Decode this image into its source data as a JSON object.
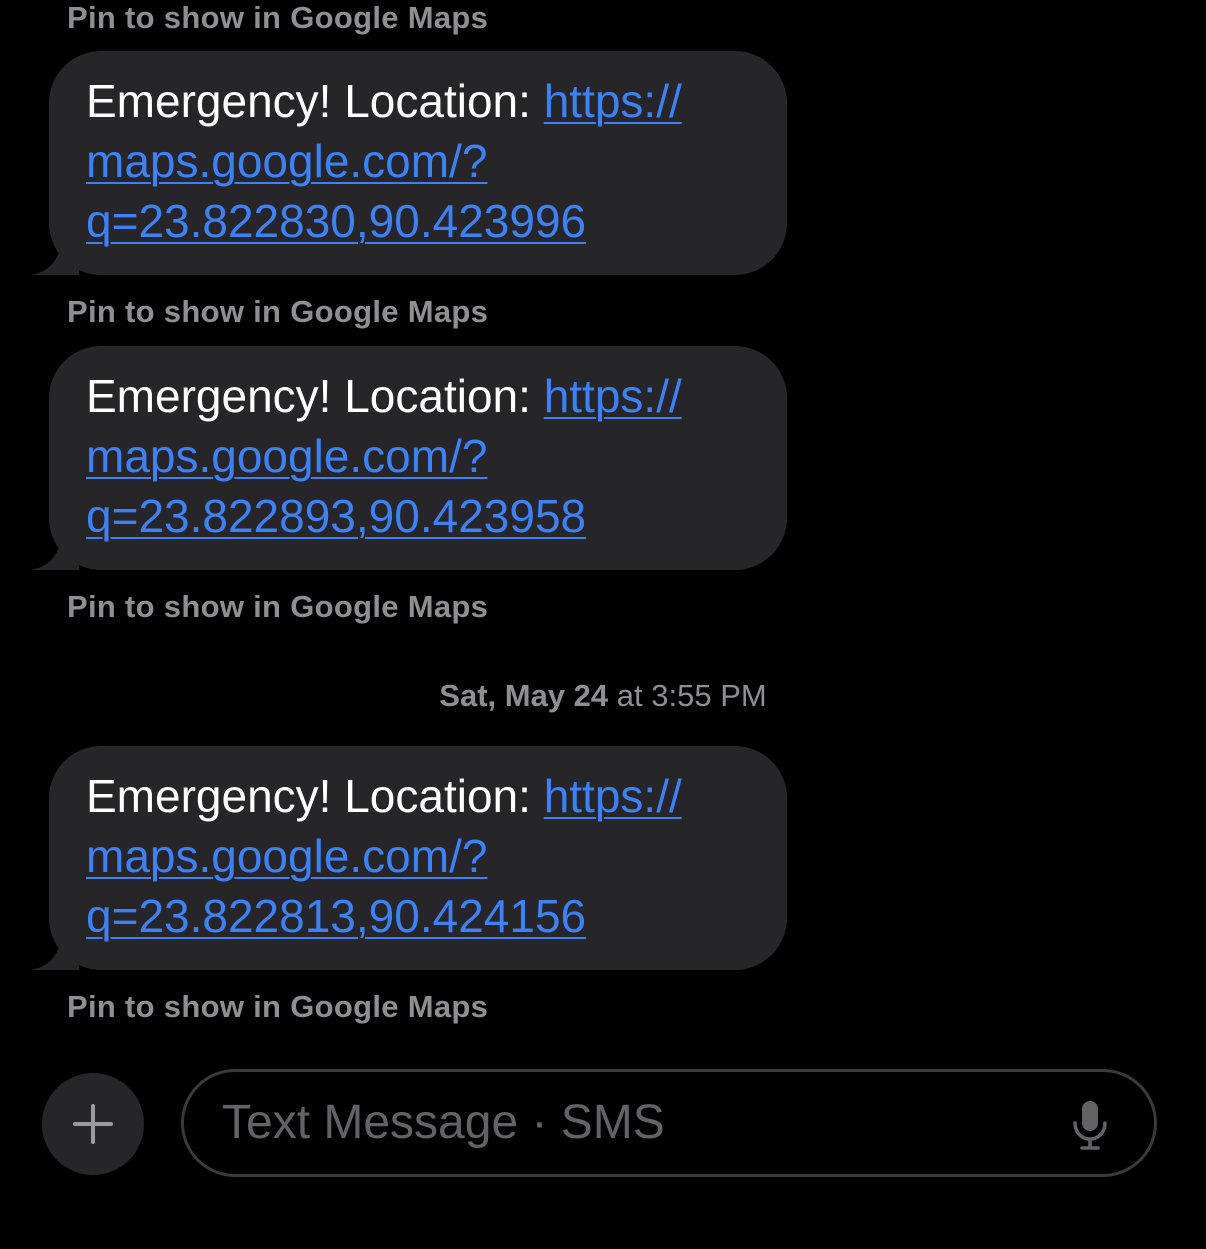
{
  "conversation": {
    "pin_caption": "Pin to show in Google Maps",
    "messages": [
      {
        "prefix": "Emergency! Location: ",
        "link_line1": "https://",
        "link_line2": "maps.google.com/?",
        "link_line3": "q=23.822830,90.423996"
      },
      {
        "prefix": "Emergency! Location: ",
        "link_line1": "https://",
        "link_line2": "maps.google.com/?",
        "link_line3": "q=23.822893,90.423958"
      },
      {
        "prefix": "Emergency! Location: ",
        "link_line1": "https://",
        "link_line2": "maps.google.com/?",
        "link_line3": "q=23.822813,90.424156"
      }
    ],
    "timestamp": {
      "day": "Sat, May 24",
      "at": " at ",
      "time": "3:55 PM"
    }
  },
  "composer": {
    "add_icon": "plus-icon",
    "placeholder": "Text Message · SMS",
    "mic_icon": "microphone-icon"
  },
  "colors": {
    "background": "#000000",
    "bubble": "#262628",
    "link": "#3b82f6",
    "caption": "#8e8e93",
    "placeholder": "#636366"
  }
}
